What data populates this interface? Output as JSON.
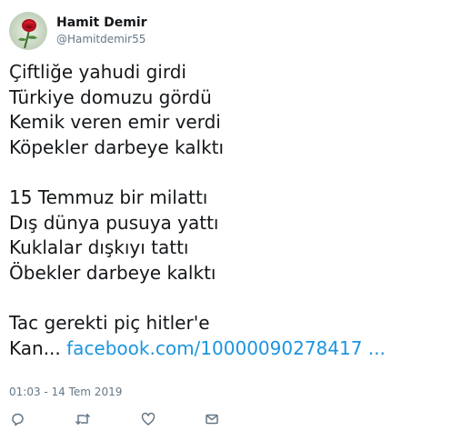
{
  "user": {
    "display_name": "Hamit Demir",
    "handle": "@Hamitdemir55",
    "avatar_icon": "red-rose-avatar"
  },
  "tweet": {
    "lines": [
      "Çiftliğe yahudi girdi",
      "Türkiye domuzu gördü",
      "Kemik veren emir verdi",
      "Köpekler darbeye kalktı",
      "",
      "15 Temmuz bir milattı",
      "Dış dünya pusuya yattı",
      "Kuklalar dışkıyı tattı",
      "Öbekler darbeye kalktı",
      "",
      "Tac gerekti piç hitler'e"
    ],
    "last_line_prefix": "Kan...",
    "link_text": "facebook.com/10000090278417 ...",
    "link_color": "#1b95e0",
    "timestamp": "01:03 - 14 Tem 2019"
  },
  "actions": {
    "reply_icon": "reply-icon",
    "retweet_icon": "retweet-icon",
    "like_icon": "heart-icon",
    "dm_icon": "envelope-icon"
  }
}
